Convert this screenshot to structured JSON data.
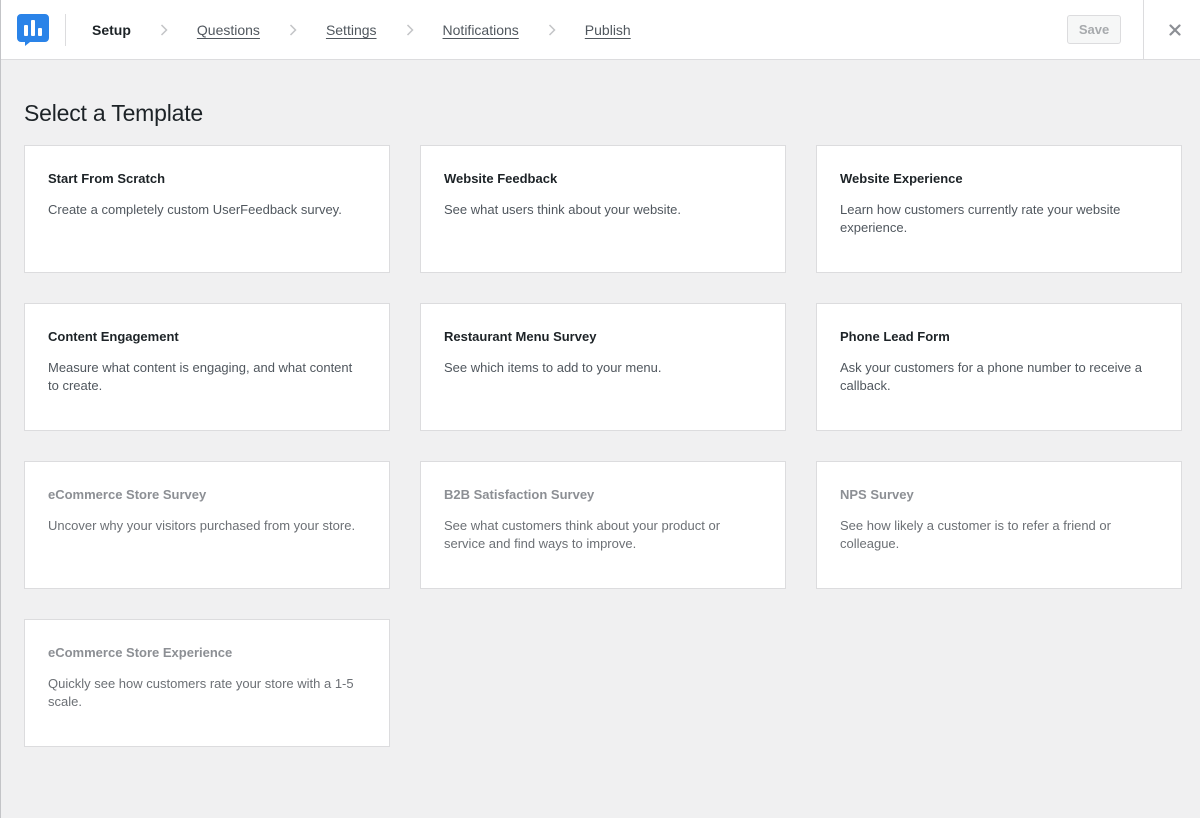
{
  "header": {
    "steps": [
      {
        "label": "Setup",
        "active": true
      },
      {
        "label": "Questions",
        "active": false
      },
      {
        "label": "Settings",
        "active": false
      },
      {
        "label": "Notifications",
        "active": false
      },
      {
        "label": "Publish",
        "active": false
      }
    ],
    "save_label": "Save",
    "logo_icon": "userfeedback-logo-icon",
    "close_icon": "close-icon",
    "chevron_icon": "chevron-right-icon",
    "colors": {
      "brand": "#2a83e8",
      "background": "#f0f0f1"
    }
  },
  "main": {
    "title": "Select a Template",
    "templates": [
      {
        "title": "Start From Scratch",
        "description": "Create a completely custom UserFeedback survey.",
        "available": true
      },
      {
        "title": "Website Feedback",
        "description": "See what users think about your website.",
        "available": true
      },
      {
        "title": "Website Experience",
        "description": "Learn how customers currently rate your website experience.",
        "available": true
      },
      {
        "title": "Content Engagement",
        "description": "Measure what content is engaging, and what content to create.",
        "available": true
      },
      {
        "title": "Restaurant Menu Survey",
        "description": "See which items to add to your menu.",
        "available": true
      },
      {
        "title": "Phone Lead Form",
        "description": "Ask your customers for a phone number to receive a callback.",
        "available": true
      },
      {
        "title": "eCommerce Store Survey",
        "description": "Uncover why your visitors purchased from your store.",
        "available": false
      },
      {
        "title": "B2B Satisfaction Survey",
        "description": "See what customers think about your product or service and find ways to improve.",
        "available": false
      },
      {
        "title": "NPS Survey",
        "description": "See how likely a customer is to refer a friend or colleague.",
        "available": false
      },
      {
        "title": "eCommerce Store Experience",
        "description": "Quickly see how customers rate your store with a 1-5 scale.",
        "available": false
      }
    ]
  }
}
